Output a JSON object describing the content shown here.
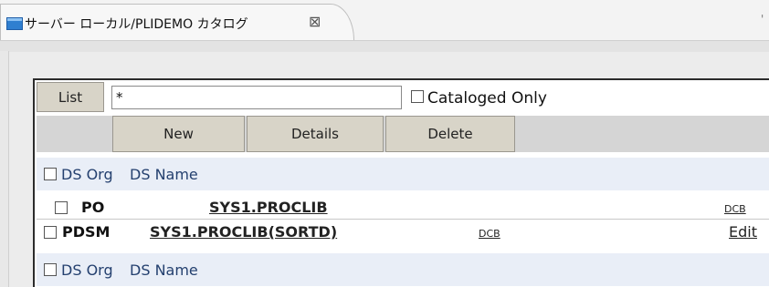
{
  "tab": {
    "title": "サーバー ローカル/PLIDEMO カタログ",
    "close_glyph": "⊠",
    "icon": "dataset-view-icon"
  },
  "toolbar": {
    "list_label": "List",
    "filter_value": "*",
    "cataloged_only_label": "Cataloged Only",
    "new_label": "New",
    "details_label": "Details",
    "delete_label": "Delete"
  },
  "table": {
    "header": {
      "org": "DS Org",
      "name": "DS Name"
    },
    "rows": [
      {
        "org": "PO",
        "name": "SYS1.PROCLIB",
        "dcb": "DCB",
        "edit": ""
      },
      {
        "org": "PDSM",
        "name": "SYS1.PROCLIB(SORTD)",
        "dcb": "DCB",
        "edit": "Edit"
      }
    ],
    "footer": {
      "org": "DS Org",
      "name": "DS Name"
    }
  },
  "colors": {
    "header_bg": "#e9eef7",
    "header_text": "#24406f",
    "button_bg": "#d8d4c8",
    "tab_icon": "#2f7fd0"
  }
}
